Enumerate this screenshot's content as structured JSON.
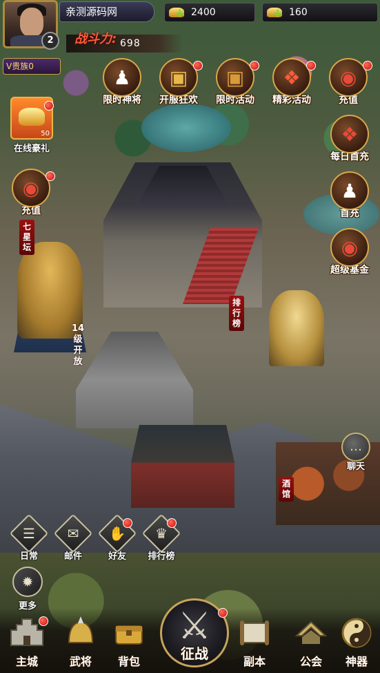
{
  "player": {
    "name": "亲测源码网",
    "level": "2",
    "vip_label": "V贵族0",
    "power_label": "战斗力:",
    "power_value": "698"
  },
  "resources": {
    "gold": "2400",
    "yuanbao": "160"
  },
  "top_activities": [
    {
      "label": "限时神将",
      "icon": "general-portrait-icon",
      "dot": false
    },
    {
      "label": "开服狂欢",
      "icon": "treasure-chest-icon",
      "dot": true
    },
    {
      "label": "限时活动",
      "icon": "treasure-chest-icon",
      "dot": true
    },
    {
      "label": "精彩活动",
      "icon": "gift-box-icon",
      "dot": true
    },
    {
      "label": "充值",
      "icon": "money-bag-icon",
      "dot": true
    }
  ],
  "left_panel": {
    "gift_label": "在线豪礼",
    "gift_count": "50",
    "recharge_label": "充值"
  },
  "right_panel": {
    "first_daily": "每日首充",
    "first_recharge": "首充",
    "fund": "超级基金"
  },
  "map_labels": {
    "qixing": "七星坛",
    "ranking": "排行榜",
    "unlock": "14级开放",
    "tavern": "酒馆"
  },
  "chat_label": "聊天",
  "quick_buttons": [
    {
      "label": "日常",
      "icon": "calendar-icon",
      "dot": false
    },
    {
      "label": "邮件",
      "icon": "mail-icon",
      "dot": false
    },
    {
      "label": "好友",
      "icon": "handshake-icon",
      "dot": true
    },
    {
      "label": "排行榜",
      "icon": "trophy-icon",
      "dot": true
    }
  ],
  "more_label": "更多",
  "nav": {
    "city": "主城",
    "generals": "武将",
    "bag": "背包",
    "war": "征战",
    "dungeon": "副本",
    "guild": "公会",
    "artifact": "神器"
  }
}
